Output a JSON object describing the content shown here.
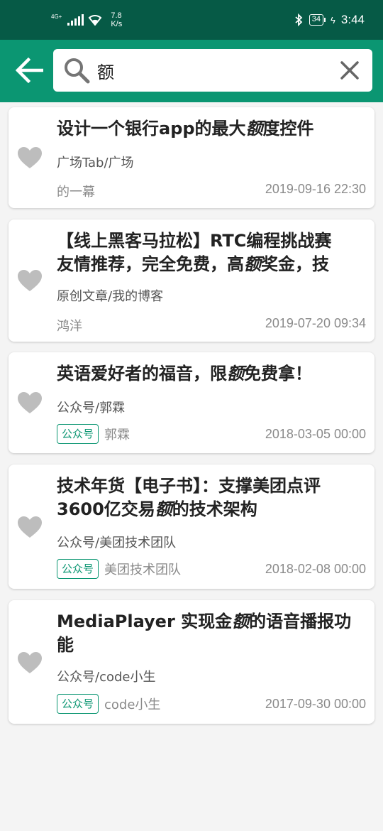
{
  "status_bar": {
    "network": "4G+",
    "speed_value": "7.8",
    "speed_unit": "K/s",
    "battery": "34",
    "time": "3:44",
    "icons": [
      "signal-icon",
      "wifi-icon",
      "bluetooth-icon",
      "battery-icon",
      "charging-icon"
    ]
  },
  "toolbar": {
    "back_icon": "arrow-left-icon",
    "search_value": "额",
    "search_icon": "search-icon",
    "clear_icon": "close-icon"
  },
  "colors": {
    "status_bar": "#065a46",
    "toolbar": "#0b9672",
    "accent": "#0b9672",
    "heart": "#bdbdbd"
  },
  "results": [
    {
      "title_before": "设计一个银行app的最大",
      "title_highlight": "额",
      "title_after": "度控件",
      "source": "广场Tab/广场",
      "tag": "",
      "author": "的一幕",
      "date": "2019-09-16 22:30"
    },
    {
      "title_before": "【线上黑客马拉松】RTC编程挑战赛友情推荐，完全免费，高",
      "title_highlight": "额",
      "title_after": "奖金，技",
      "title_line1": "【线上黑客马拉松】RTC编程挑战赛",
      "title_line2_before": "友情推荐，完全免费，高",
      "source": "原创文章/我的博客",
      "tag": "",
      "author": "鸿洋",
      "date": "2019-07-20 09:34"
    },
    {
      "title_before": "英语爱好者的福音，限",
      "title_highlight": "额",
      "title_after": "免费拿！",
      "source": "公众号/郭霖",
      "tag": "公众号",
      "author": "郭霖",
      "date": "2018-03-05 00:00"
    },
    {
      "title_before": "技术年货【电子书】：支撑美团点评3600亿交易",
      "title_highlight": "额",
      "title_after": "的技术架构",
      "title_line1": "技术年货【电子书】：支撑美团点评",
      "title_line2_before": "3600亿交易",
      "source": "公众号/美团技术团队",
      "tag": "公众号",
      "author": "美团技术团队",
      "date": "2018-02-08 00:00"
    },
    {
      "title_before": "MediaPlayer 实现金",
      "title_highlight": "额",
      "title_after": "的语音播报功能",
      "title_line1_before": "MediaPlayer 实现金",
      "title_line1_after": "的语音播报功",
      "title_line2": "能",
      "source": "公众号/code小生",
      "tag": "公众号",
      "author": "code小生",
      "date": "2017-09-30 00:00"
    }
  ]
}
